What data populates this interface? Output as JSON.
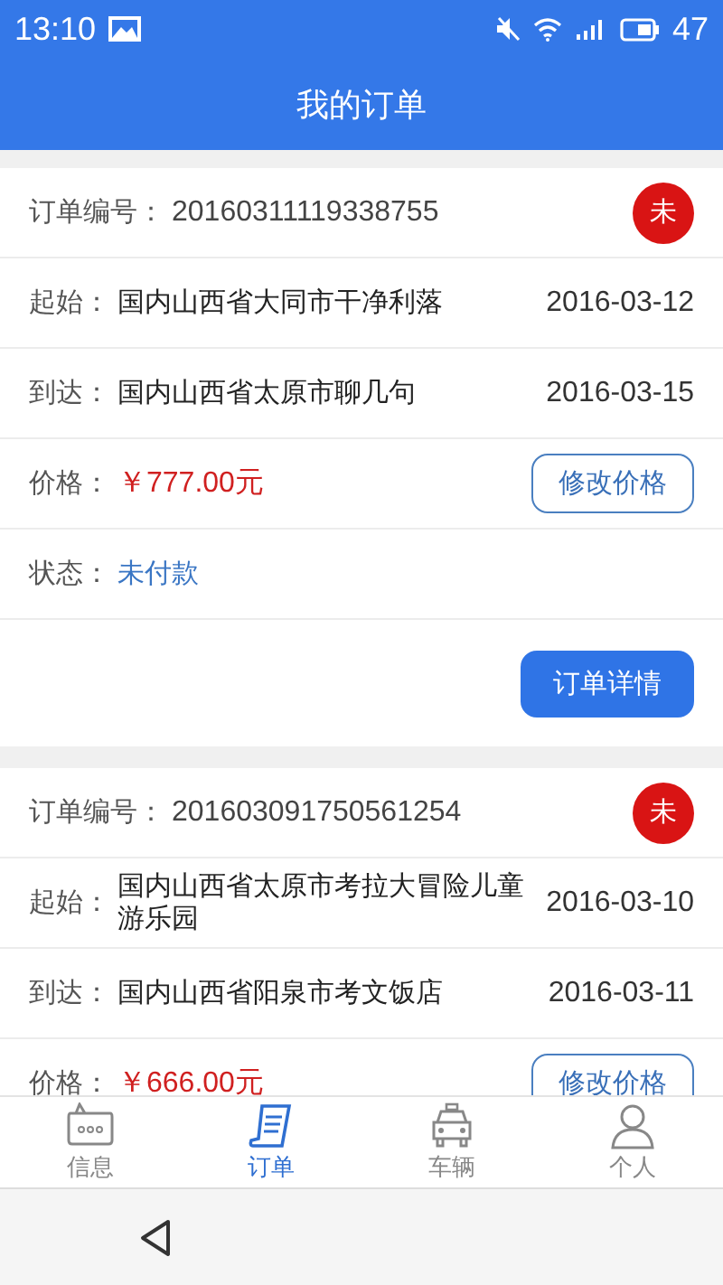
{
  "status_bar": {
    "time": "13:10",
    "battery": "47"
  },
  "header": {
    "title": "我的订单"
  },
  "orders": [
    {
      "number_label": "订单编号：",
      "number": "20160311119338755",
      "badge": "未",
      "start_label": "起始：",
      "start": "国内山西省大同市干净利落",
      "start_date": "2016-03-12",
      "dest_label": "到达：",
      "dest": "国内山西省太原市聊几句",
      "dest_date": "2016-03-15",
      "price_label": "价格：",
      "price": "￥777.00元",
      "price_button": "修改价格",
      "status_label": "状态：",
      "status": "未付款",
      "detail_button": "订单详情"
    },
    {
      "number_label": "订单编号：",
      "number": "201603091750561254",
      "badge": "未",
      "start_label": "起始：",
      "start": "国内山西省太原市考拉大冒险儿童游乐园",
      "start_date": "2016-03-10",
      "dest_label": "到达：",
      "dest": "国内山西省阳泉市考文饭店",
      "dest_date": "2016-03-11",
      "price_label": "价格：",
      "price": "￥666.00元",
      "price_button": "修改价格"
    }
  ],
  "tabs": [
    {
      "kind": "chat",
      "label": "信息",
      "selected": false
    },
    {
      "kind": "doc",
      "label": "订单",
      "selected": true
    },
    {
      "kind": "car",
      "label": "车辆",
      "selected": false
    },
    {
      "kind": "person",
      "label": "个人",
      "selected": false
    }
  ]
}
